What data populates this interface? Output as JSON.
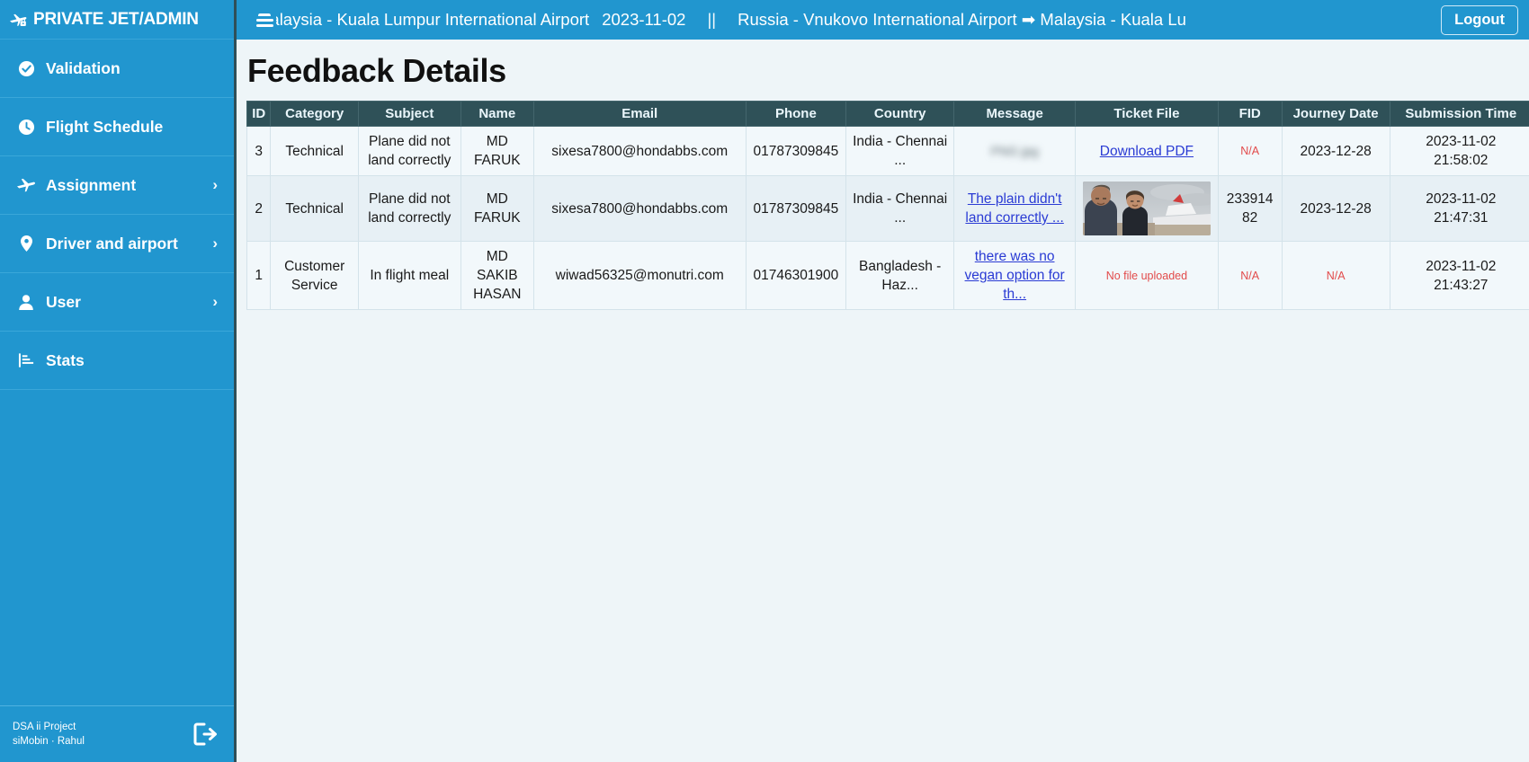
{
  "brand": {
    "title": "PRIVATE JET/ADMIN",
    "icon": "plane-lock-icon"
  },
  "sidebar": {
    "items": [
      {
        "label": "Validation",
        "icon": "check-circle-icon",
        "chevron": "",
        "name": "validation"
      },
      {
        "label": "Flight Schedule",
        "icon": "clock-icon",
        "chevron": "",
        "name": "flight-schedule"
      },
      {
        "label": "Assignment",
        "icon": "plane-icon",
        "chevron": "›",
        "name": "assignment"
      },
      {
        "label": "Driver and airport",
        "icon": "map-pin-icon",
        "chevron": "›",
        "name": "driver-and-airport"
      },
      {
        "label": "User",
        "icon": "user-icon",
        "chevron": "›",
        "name": "user"
      },
      {
        "label": "Stats",
        "icon": "bar-chart-icon",
        "chevron": "",
        "name": "stats"
      }
    ],
    "footer": {
      "project": "DSA ii Project",
      "credits": "siMobin  ·  Rahul",
      "logout_icon": "logout-icon"
    }
  },
  "topbar": {
    "menu_icon": "hamburger-icon",
    "ticker_segment_1": "Malaysia - Kuala Lumpur International Airport",
    "ticker_date": "2023-11-02",
    "ticker_separator": "||",
    "ticker_segment_2": "Russia - Vnukovo International Airport ➡ Malaysia - Kuala Lu",
    "logout_label": "Logout"
  },
  "page": {
    "title": "Feedback Details"
  },
  "table": {
    "columns": [
      "ID",
      "Category",
      "Subject",
      "Name",
      "Email",
      "Phone",
      "Country",
      "Message",
      "Ticket File",
      "FID",
      "Journey Date",
      "Submission Time"
    ],
    "rows": [
      {
        "id": "3",
        "category": "Technical",
        "subject": "Plane did not land correctly",
        "name": "MD FARUK",
        "email": "sixesa7800@hondabbs.com",
        "phone": "01787309845",
        "country": "India - Chennai ...",
        "message": "PNG jpg",
        "message_style": "blurred",
        "ticket_file": "Download PDF",
        "ticket_style": "link",
        "fid": "N/A",
        "fid_style": "na",
        "journey_date": "2023-12-28",
        "journey_style": "text",
        "submission_date": "2023-11-02",
        "submission_time": "21:58:02"
      },
      {
        "id": "2",
        "category": "Technical",
        "subject": "Plane did not land correctly",
        "name": "MD FARUK",
        "email": "sixesa7800@hondabbs.com",
        "phone": "01787309845",
        "country": "India - Chennai ...",
        "message": "The plain didn't land correctly ...",
        "message_style": "link",
        "ticket_file": "beach-plane-photo",
        "ticket_style": "image",
        "fid": "23391482",
        "fid_style": "text",
        "journey_date": "2023-12-28",
        "journey_style": "text",
        "submission_date": "2023-11-02",
        "submission_time": "21:47:31"
      },
      {
        "id": "1",
        "category": "Customer Service",
        "subject": "In flight meal",
        "name": "MD SAKIB HASAN",
        "email": "wiwad56325@monutri.com",
        "phone": "01746301900",
        "country": "Bangladesh - Haz...",
        "message": "there was no vegan option for th...",
        "message_style": "link",
        "ticket_file": "No file uploaded",
        "ticket_style": "nofile",
        "fid": "N/A",
        "fid_style": "na",
        "journey_date": "N/A",
        "journey_style": "na",
        "submission_date": "2023-11-02",
        "submission_time": "21:43:27"
      }
    ]
  },
  "colors": {
    "sidebar": "#2196cf",
    "topbar": "#2196cf",
    "table_header": "#2f5158",
    "page_bg": "#eef5f8",
    "link": "#2a3bd4",
    "danger": "#e24b4b"
  }
}
